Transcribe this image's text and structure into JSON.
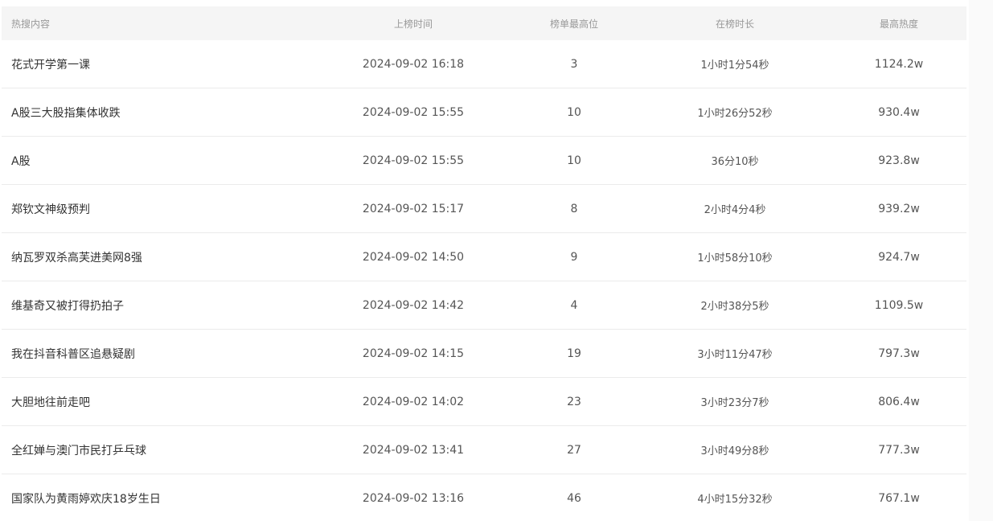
{
  "table": {
    "headers": {
      "title": "热搜内容",
      "time": "上榜时间",
      "rank": "榜单最高位",
      "duration": "在榜时长",
      "heat": "最高热度"
    },
    "rows": [
      {
        "title": "花式开学第一课",
        "time": "2024-09-02 16:18",
        "rank": "3",
        "duration": "1小时1分54秒",
        "heat": "1124.2w"
      },
      {
        "title": "A股三大股指集体收跌",
        "time": "2024-09-02 15:55",
        "rank": "10",
        "duration": "1小时26分52秒",
        "heat": "930.4w"
      },
      {
        "title": "A股",
        "time": "2024-09-02 15:55",
        "rank": "10",
        "duration": "36分10秒",
        "heat": "923.8w"
      },
      {
        "title": "郑钦文神级预判",
        "time": "2024-09-02 15:17",
        "rank": "8",
        "duration": "2小时4分4秒",
        "heat": "939.2w"
      },
      {
        "title": "纳瓦罗双杀高芙进美网8强",
        "time": "2024-09-02 14:50",
        "rank": "9",
        "duration": "1小时58分10秒",
        "heat": "924.7w"
      },
      {
        "title": "维基奇又被打得扔拍子",
        "time": "2024-09-02 14:42",
        "rank": "4",
        "duration": "2小时38分5秒",
        "heat": "1109.5w"
      },
      {
        "title": "我在抖音科普区追悬疑剧",
        "time": "2024-09-02 14:15",
        "rank": "19",
        "duration": "3小时11分47秒",
        "heat": "797.3w"
      },
      {
        "title": "大胆地往前走吧",
        "time": "2024-09-02 14:02",
        "rank": "23",
        "duration": "3小时23分7秒",
        "heat": "806.4w"
      },
      {
        "title": "全红婵与澳门市民打乒乓球",
        "time": "2024-09-02 13:41",
        "rank": "27",
        "duration": "3小时49分8秒",
        "heat": "777.3w"
      },
      {
        "title": "国家队为黄雨婷欢庆18岁生日",
        "time": "2024-09-02 13:16",
        "rank": "46",
        "duration": "4小时15分32秒",
        "heat": "767.1w"
      }
    ]
  }
}
